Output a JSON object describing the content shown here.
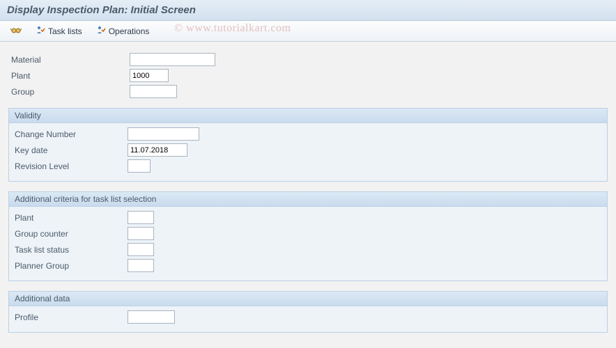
{
  "header": {
    "title": "Display Inspection Plan: Initial Screen"
  },
  "toolbar": {
    "task_lists_label": "Task lists",
    "operations_label": "Operations"
  },
  "watermark": {
    "text": "© www.tutorialkart.com"
  },
  "top_fields": {
    "material_label": "Material",
    "material_value": "",
    "plant_label": "Plant",
    "plant_value": "1000",
    "group_label": "Group",
    "group_value": ""
  },
  "validity": {
    "title": "Validity",
    "change_number_label": "Change Number",
    "change_number_value": "",
    "key_date_label": "Key date",
    "key_date_value": "11.07.2018",
    "revision_level_label": "Revision Level",
    "revision_level_value": ""
  },
  "additional_criteria": {
    "title": "Additional criteria for task list selection",
    "plant_label": "Plant",
    "plant_value": "",
    "group_counter_label": "Group counter",
    "group_counter_value": "",
    "task_list_status_label": "Task list status",
    "task_list_status_value": "",
    "planner_group_label": "Planner Group",
    "planner_group_value": ""
  },
  "additional_data": {
    "title": "Additional data",
    "profile_label": "Profile",
    "profile_value": ""
  }
}
